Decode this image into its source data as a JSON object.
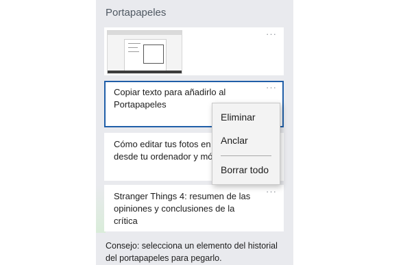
{
  "panel": {
    "title": "Portapapeles",
    "more_icon": "···",
    "items": [
      {
        "type": "image"
      },
      {
        "type": "text",
        "text": "Copiar texto para añadirlo al Portapapeles"
      },
      {
        "type": "text",
        "text": "Cómo editar tus fotos en G Fotos desde tu ordenador y móvil"
      },
      {
        "type": "text",
        "text": "Stranger Things 4: resumen de las opiniones y conclusiones de la crítica"
      }
    ],
    "tip": "Consejo: selecciona un elemento del historial del portapapeles para pegarlo."
  },
  "context_menu": {
    "delete_label": "Eliminar",
    "pin_label": "Anclar",
    "clear_all_label": "Borrar todo"
  },
  "colors": {
    "panel_bg": "#e9eaee",
    "selection_border": "#1f5ea8"
  }
}
